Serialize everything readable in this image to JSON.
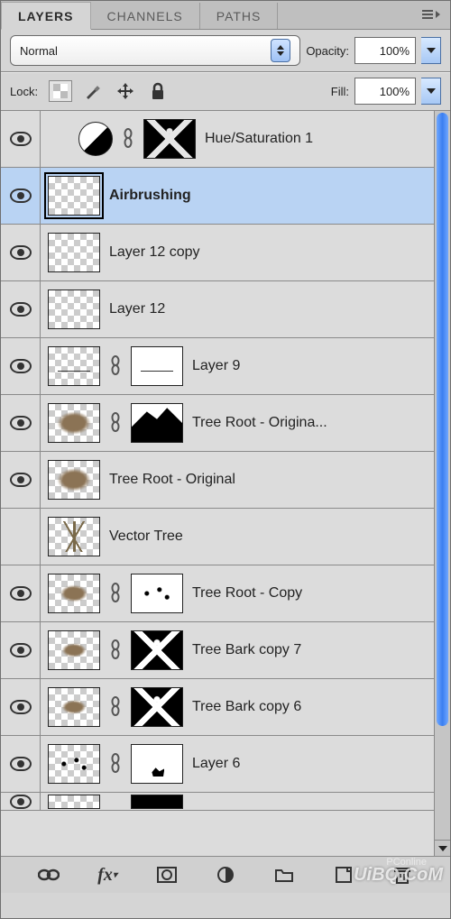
{
  "tabs": {
    "layers": "LAYERS",
    "channels": "CHANNELS",
    "paths": "PATHS"
  },
  "blend": {
    "mode": "Normal",
    "opacity_label": "Opacity:",
    "opacity_value": "100%"
  },
  "lock": {
    "label": "Lock:",
    "fill_label": "Fill:",
    "fill_value": "100%"
  },
  "layers": [
    {
      "name": "Hue/Saturation 1",
      "visible": true,
      "type": "adjustment",
      "has_mask": true,
      "selected": false
    },
    {
      "name": "Airbrushing",
      "visible": true,
      "type": "pixel",
      "has_mask": false,
      "selected": true
    },
    {
      "name": "Layer 12 copy",
      "visible": true,
      "type": "pixel",
      "has_mask": false,
      "selected": false
    },
    {
      "name": "Layer 12",
      "visible": true,
      "type": "pixel",
      "has_mask": false,
      "selected": false
    },
    {
      "name": "Layer 9",
      "visible": true,
      "type": "pixel",
      "has_mask": true,
      "selected": false
    },
    {
      "name": "Tree Root - Origina...",
      "visible": true,
      "type": "pixel",
      "has_mask": true,
      "selected": false
    },
    {
      "name": "Tree Root - Original",
      "visible": true,
      "type": "pixel",
      "has_mask": false,
      "selected": false
    },
    {
      "name": "Vector Tree",
      "visible": false,
      "type": "pixel",
      "has_mask": false,
      "selected": false
    },
    {
      "name": "Tree Root - Copy",
      "visible": true,
      "type": "pixel",
      "has_mask": true,
      "selected": false
    },
    {
      "name": "Tree Bark copy 7",
      "visible": true,
      "type": "pixel",
      "has_mask": true,
      "selected": false
    },
    {
      "name": "Tree Bark copy 6",
      "visible": true,
      "type": "pixel",
      "has_mask": true,
      "selected": false
    },
    {
      "name": "Layer 6",
      "visible": true,
      "type": "pixel",
      "has_mask": true,
      "selected": false
    }
  ],
  "bottom_icons": {
    "link": "link-icon",
    "fx": "fx",
    "mask": "mask-icon",
    "adjust": "adjustment-icon",
    "group": "group-icon",
    "new": "new-layer-icon",
    "trash": "trash-icon"
  },
  "watermark": "UiBQ.CoM",
  "watermark2": "PConline"
}
